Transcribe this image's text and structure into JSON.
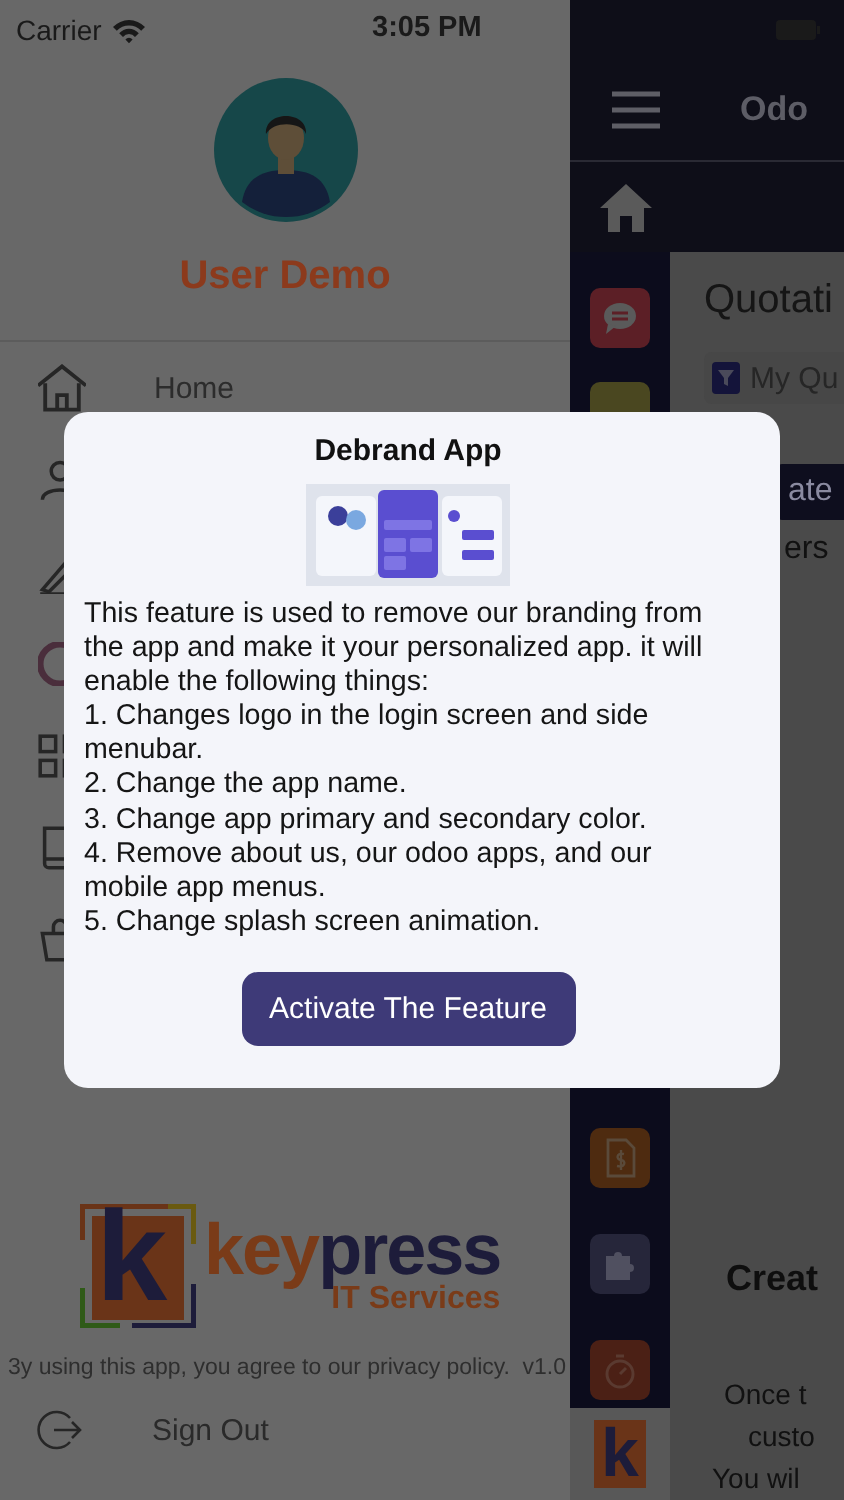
{
  "status_bar": {
    "carrier": "Carrier",
    "time": "3:05 PM"
  },
  "drawer": {
    "user_name": "User Demo",
    "menu": [
      {
        "kind": "home",
        "label": "Home"
      },
      {
        "kind": "person"
      },
      {
        "kind": "pen"
      },
      {
        "kind": "ring"
      },
      {
        "kind": "grid"
      },
      {
        "kind": "book"
      },
      {
        "kind": "bag"
      }
    ],
    "logo": {
      "mark": "k",
      "word_1": "key",
      "word_2": "press",
      "tagline": "IT Services"
    },
    "privacy_note": "3y using this app, you agree to our privacy policy.",
    "version": "v1.0",
    "sign_out": "Sign Out"
  },
  "app": {
    "title": "Odo",
    "page_title": "Quotati",
    "filter": "My Qu",
    "button": "ate",
    "subtitle": "ers",
    "apps_top": [
      {
        "kind": "chat",
        "color": "#5c1f26"
      },
      {
        "kind": "tile",
        "color": "#4a4720"
      }
    ],
    "apps_bottom": [
      {
        "kind": "dollar",
        "color": "#4e2b10"
      },
      {
        "kind": "puzzle",
        "color": "#26263a"
      },
      {
        "kind": "stopwatch",
        "color": "#4b2015"
      }
    ],
    "brand_tile": {
      "mark": "k"
    },
    "empty_title": "Creat",
    "empty_lines": [
      "Once t",
      "custo",
      "You wil"
    ]
  },
  "dialog": {
    "title": "Debrand App",
    "intro": "This feature is used to remove our branding from the app and make it your personalized app. it will enable the following things:",
    "steps": [
      "1. Changes logo in the login screen and side menubar.",
      "2. Change the app name.",
      "3. Change app primary and secondary color.",
      "4. Remove about us, our odoo apps, and our mobile app menus.",
      "5. Change splash screen animation."
    ],
    "button": "Activate The Feature"
  }
}
